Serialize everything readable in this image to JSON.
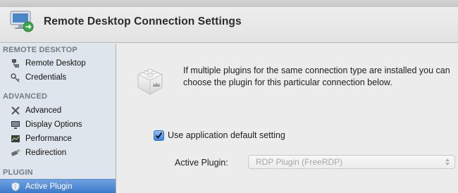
{
  "window": {
    "title": "Remote Desktop Connection Settings"
  },
  "sidebar": {
    "sections": [
      {
        "label": "REMOTE DESKTOP"
      },
      {
        "label": "ADVANCED"
      },
      {
        "label": "PLUGIN"
      }
    ],
    "items": [
      {
        "label": "Remote Desktop",
        "icon": "connection-icon"
      },
      {
        "label": "Credentials",
        "icon": "key-icon"
      },
      {
        "label": "Advanced",
        "icon": "tools-icon"
      },
      {
        "label": "Display Options",
        "icon": "display-icon"
      },
      {
        "label": "Performance",
        "icon": "performance-icon"
      },
      {
        "label": "Redirection",
        "icon": "redirection-icon"
      },
      {
        "label": "Active Plugin",
        "icon": "plugin-shield-icon",
        "selected": true
      }
    ]
  },
  "main": {
    "info_text": "If multiple plugins for the same connection type are installed you can choose the plugin for this particular connection below.",
    "use_default": {
      "label": "Use application default setting",
      "checked": true
    },
    "active_plugin": {
      "label": "Active Plugin:",
      "value": "RDP Plugin (FreeRDP)",
      "enabled": false
    }
  },
  "colors": {
    "selection": "#3d79cc",
    "sidebar_bg": "#dfe5ed",
    "checkbox": "#3d86e3"
  }
}
